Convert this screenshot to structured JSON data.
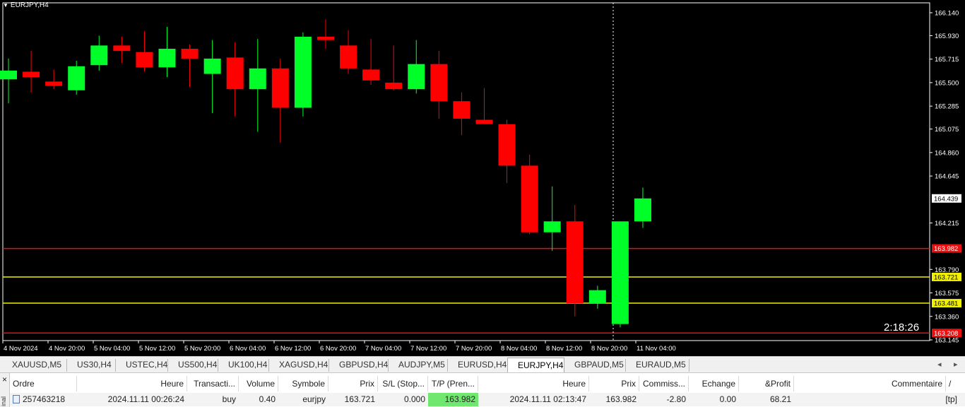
{
  "window": {
    "title": "EURJPY,H4"
  },
  "chart": {
    "timer": "2:18:26"
  },
  "chart_data": {
    "type": "candlestick",
    "symbol": "EURJPY",
    "timeframe": "H4",
    "price_axis": {
      "ticks": [
        "166.140",
        "165.930",
        "165.715",
        "165.500",
        "165.285",
        "165.075",
        "164.860",
        "164.645",
        "164.215",
        "163.790",
        "163.575",
        "163.360",
        "163.145"
      ],
      "current_price_label": "164.439"
    },
    "time_axis": {
      "labels": [
        "4 Nov 2024",
        "4 Nov 20:00",
        "5 Nov 04:00",
        "5 Nov 12:00",
        "5 Nov 20:00",
        "6 Nov 04:00",
        "6 Nov 12:00",
        "6 Nov 20:00",
        "7 Nov 04:00",
        "7 Nov 12:00",
        "7 Nov 20:00",
        "8 Nov 04:00",
        "8 Nov 12:00",
        "8 Nov 20:00",
        "11 Nov 04:00"
      ]
    },
    "candles": [
      {
        "o": 165.53,
        "h": 165.72,
        "l": 165.31,
        "c": 165.61
      },
      {
        "o": 165.6,
        "h": 165.79,
        "l": 165.41,
        "c": 165.55
      },
      {
        "o": 165.51,
        "h": 165.62,
        "l": 165.44,
        "c": 165.47
      },
      {
        "o": 165.43,
        "h": 165.7,
        "l": 165.39,
        "c": 165.65
      },
      {
        "o": 165.66,
        "h": 165.93,
        "l": 165.61,
        "c": 165.84
      },
      {
        "o": 165.84,
        "h": 165.92,
        "l": 165.68,
        "c": 165.79
      },
      {
        "o": 165.78,
        "h": 165.97,
        "l": 165.6,
        "c": 165.64
      },
      {
        "o": 165.64,
        "h": 166.01,
        "l": 165.55,
        "c": 165.81
      },
      {
        "o": 165.81,
        "h": 165.85,
        "l": 165.46,
        "c": 165.72
      },
      {
        "o": 165.58,
        "h": 165.89,
        "l": 165.22,
        "c": 165.72
      },
      {
        "o": 165.73,
        "h": 165.87,
        "l": 165.19,
        "c": 165.44
      },
      {
        "o": 165.44,
        "h": 165.9,
        "l": 165.05,
        "c": 165.63
      },
      {
        "o": 165.63,
        "h": 165.72,
        "l": 164.95,
        "c": 165.27
      },
      {
        "o": 165.27,
        "h": 165.96,
        "l": 165.19,
        "c": 165.92
      },
      {
        "o": 165.92,
        "h": 166.08,
        "l": 165.81,
        "c": 165.89
      },
      {
        "o": 165.84,
        "h": 165.98,
        "l": 165.58,
        "c": 165.63
      },
      {
        "o": 165.62,
        "h": 165.9,
        "l": 165.48,
        "c": 165.52
      },
      {
        "o": 165.5,
        "h": 165.84,
        "l": 165.43,
        "c": 165.44
      },
      {
        "o": 165.44,
        "h": 165.89,
        "l": 165.4,
        "c": 165.67
      },
      {
        "o": 165.67,
        "h": 165.79,
        "l": 165.17,
        "c": 165.33
      },
      {
        "o": 165.33,
        "h": 165.41,
        "l": 165.02,
        "c": 165.17
      },
      {
        "o": 165.16,
        "h": 165.45,
        "l": 165.14,
        "c": 165.12
      },
      {
        "o": 165.12,
        "h": 165.16,
        "l": 164.58,
        "c": 164.74
      },
      {
        "o": 164.74,
        "h": 164.84,
        "l": 164.11,
        "c": 164.13
      },
      {
        "o": 164.13,
        "h": 164.55,
        "l": 163.96,
        "c": 164.23
      },
      {
        "o": 164.23,
        "h": 164.38,
        "l": 163.36,
        "c": 163.48
      },
      {
        "o": 163.48,
        "h": 163.64,
        "l": 163.43,
        "c": 163.6
      },
      {
        "o": 163.29,
        "h": 164.2,
        "l": 163.26,
        "c": 164.23
      },
      {
        "o": 164.23,
        "h": 164.54,
        "l": 164.17,
        "c": 164.44
      }
    ],
    "levels": [
      {
        "value": 163.982,
        "label": "163.982",
        "color": "#e81010"
      },
      {
        "value": 163.721,
        "label": "163.721",
        "color": "#f0f000"
      },
      {
        "value": 163.481,
        "label": "163.481",
        "color": "#f0f000"
      },
      {
        "value": 163.208,
        "label": "163.208",
        "color": "#e81010"
      }
    ],
    "colors": {
      "bull": "#00ff28",
      "bear": "#ff0000",
      "background": "#000000",
      "grid_axis": "#ffffff"
    }
  },
  "tabs": [
    {
      "label": "XAUUSD,M5"
    },
    {
      "label": "US30,H4"
    },
    {
      "label": "USTEC,H4"
    },
    {
      "label": "US500,H4"
    },
    {
      "label": "UK100,H4"
    },
    {
      "label": "XAGUSD,H4"
    },
    {
      "label": "GBPUSD,H4"
    },
    {
      "label": "AUDJPY,M5"
    },
    {
      "label": "EURUSD,H4"
    },
    {
      "label": "EURJPY,H4",
      "active": true
    },
    {
      "label": "GBPAUD,M5"
    },
    {
      "label": "EURAUD,M5"
    }
  ],
  "terminal": {
    "side_label": "inal",
    "close": "×",
    "headers": [
      "Ordre",
      "Heure",
      "Transacti...",
      "Volume",
      "Symbole",
      "Prix",
      "S/L (Stop...",
      "T/P (Pren...",
      "Heure",
      "Prix",
      "Commiss...",
      "Echange",
      "&Profit",
      "Commentaire"
    ],
    "sort_indicator": "/",
    "row": [
      "257463218",
      "2024.11.11 00:26:24",
      "buy",
      "0.40",
      "eurjpy",
      "163.721",
      "0.000",
      "163.982",
      "2024.11.11 02:13:47",
      "163.982",
      "-2.80",
      "0.00",
      "68.21",
      "[tp]"
    ]
  },
  "icons": {
    "order": "order-icon",
    "close": "close-icon",
    "title_menu": "triangle-down-icon"
  }
}
